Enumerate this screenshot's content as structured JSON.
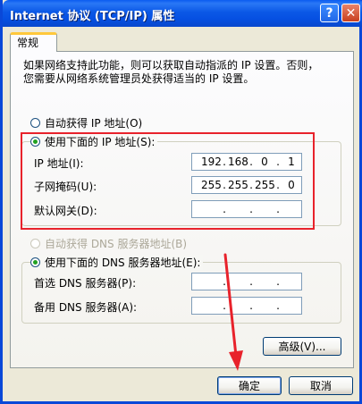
{
  "window": {
    "title": "Internet 协议 (TCP/IP) 属性",
    "help_symbol": "?",
    "close_symbol": "✕"
  },
  "tab": {
    "label": "常规"
  },
  "description": {
    "line1": "如果网络支持此功能，则可以获取自动指派的 IP 设置。否则，",
    "line2": "您需要从网络系统管理员处获得适当的 IP 设置。"
  },
  "ip_section": {
    "auto_label": "自动获得 IP 地址(O)",
    "auto_checked": false,
    "manual_label": "使用下面的 IP 地址(S):",
    "manual_checked": true,
    "ip_address": {
      "label": "IP 地址(I):",
      "octets": [
        "192",
        "168",
        "0",
        "1"
      ]
    },
    "subnet_mask": {
      "label": "子网掩码(U):",
      "octets": [
        "255",
        "255",
        "255",
        "0"
      ]
    },
    "default_gateway": {
      "label": "默认网关(D):",
      "octets": [
        "",
        "",
        "",
        ""
      ]
    }
  },
  "dns_section": {
    "auto_label": "自动获得 DNS 服务器地址(B)",
    "auto_disabled": true,
    "manual_label": "使用下面的 DNS 服务器地址(E):",
    "manual_checked": true,
    "preferred": {
      "label": "首选 DNS 服务器(P):",
      "octets": [
        "",
        "",
        "",
        ""
      ]
    },
    "alternate": {
      "label": "备用 DNS 服务器(A):",
      "octets": [
        "",
        "",
        "",
        ""
      ]
    }
  },
  "buttons": {
    "advanced": "高级(V)...",
    "ok": "确定",
    "cancel": "取消"
  },
  "colors": {
    "title_bar": "#0a5bf0",
    "annotation": "#e8222b",
    "checked_radio": "#21a121"
  }
}
